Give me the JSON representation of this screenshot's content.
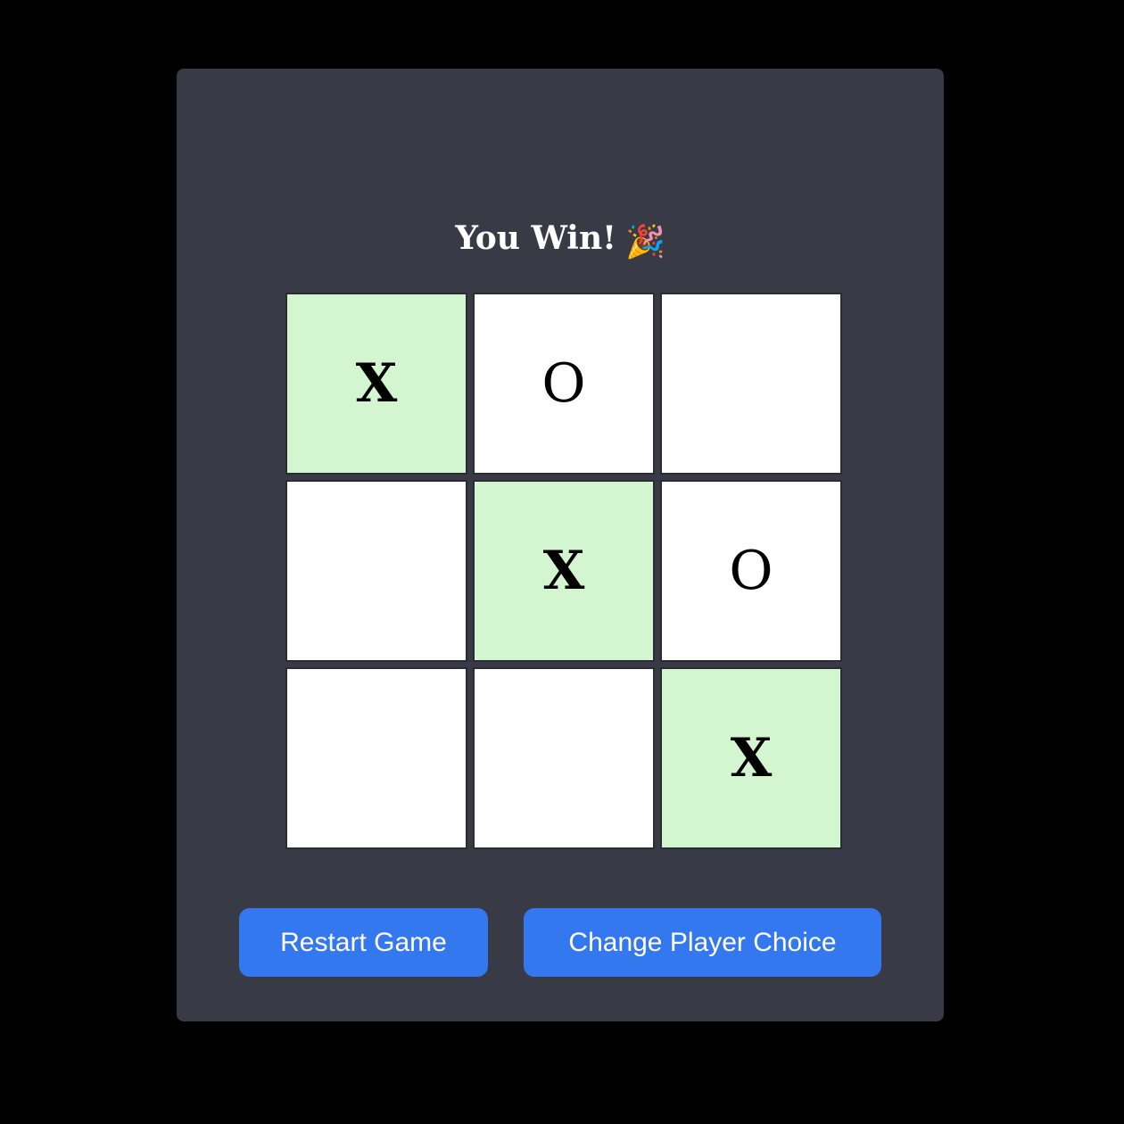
{
  "status": {
    "text": "You Win!",
    "emoji": "🎉"
  },
  "board": {
    "cells": [
      {
        "mark": "X",
        "highlight": true
      },
      {
        "mark": "O",
        "highlight": false
      },
      {
        "mark": "",
        "highlight": false
      },
      {
        "mark": "",
        "highlight": false
      },
      {
        "mark": "X",
        "highlight": true
      },
      {
        "mark": "O",
        "highlight": false
      },
      {
        "mark": "",
        "highlight": false
      },
      {
        "mark": "",
        "highlight": false
      },
      {
        "mark": "X",
        "highlight": true
      }
    ]
  },
  "buttons": {
    "restart_label": "Restart Game",
    "change_label": "Change Player Choice"
  },
  "colors": {
    "page_background": "#000000",
    "panel_background": "#383a46",
    "cell_default": "#ffffff",
    "cell_highlight": "#d3f5cf",
    "button": "#3478f0",
    "text_light": "#ffffff"
  }
}
